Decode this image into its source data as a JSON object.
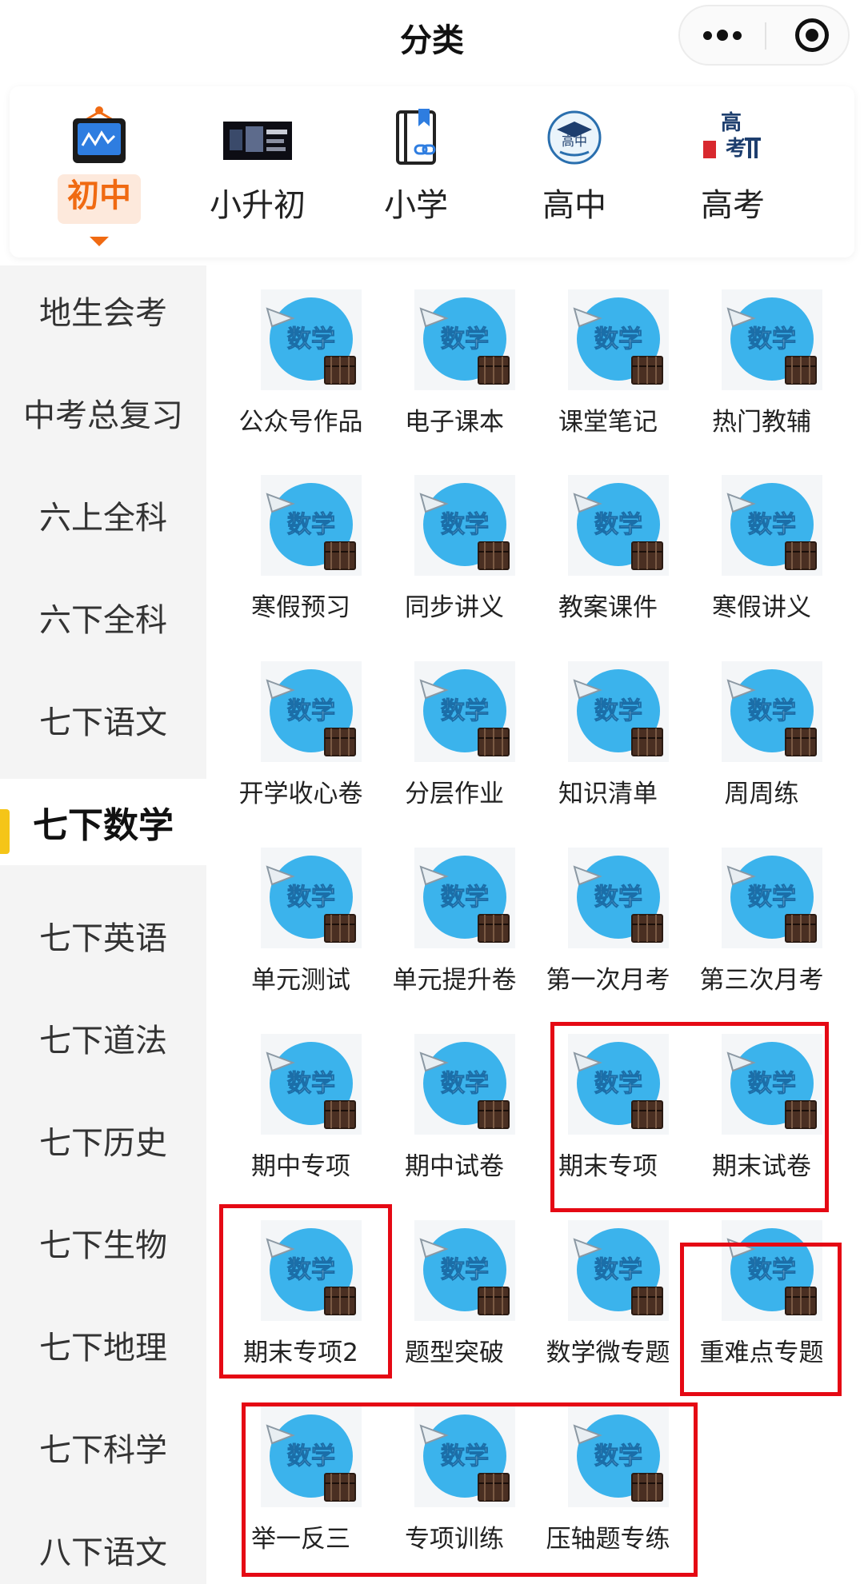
{
  "title": "分类",
  "capsule": {
    "more_icon": "more-dots-icon",
    "close_icon": "target-circle-icon"
  },
  "stages": [
    {
      "label": "初中",
      "icon": "whiteboard-icon",
      "active": true
    },
    {
      "label": "小升初",
      "icon": "banner-thumbnail-icon",
      "active": false
    },
    {
      "label": "小学",
      "icon": "book-link-icon",
      "active": false
    },
    {
      "label": "高中",
      "icon": "high-school-badge-icon",
      "active": false
    },
    {
      "label": "高考",
      "icon": "gaokao-gate-icon",
      "active": false
    }
  ],
  "sidebar": {
    "items": [
      {
        "label": "地生会考",
        "active": false
      },
      {
        "label": "中考总复习",
        "active": false
      },
      {
        "label": "六上全科",
        "active": false
      },
      {
        "label": "六下全科",
        "active": false
      },
      {
        "label": "七下语文",
        "active": false
      },
      {
        "label": "七下数学",
        "active": true
      },
      {
        "label": "七下英语",
        "active": false
      },
      {
        "label": "七下道法",
        "active": false
      },
      {
        "label": "七下历史",
        "active": false
      },
      {
        "label": "七下生物",
        "active": false
      },
      {
        "label": "七下地理",
        "active": false
      },
      {
        "label": "七下科学",
        "active": false
      },
      {
        "label": "八下语文",
        "active": false
      }
    ]
  },
  "icon_text": "数学",
  "grid": {
    "items": [
      "公众号作品",
      "电子课本",
      "课堂笔记",
      "热门教辅",
      "寒假预习",
      "同步讲义",
      "教案课件",
      "寒假讲义",
      "开学收心卷",
      "分层作业",
      "知识清单",
      "周周练",
      "单元测试",
      "单元提升卷",
      "第一次月考",
      "第三次月考",
      "期中专项",
      "期中试卷",
      "期末专项",
      "期末试卷",
      "期末专项2",
      "题型突破",
      "数学微专题",
      "重难点专题",
      "举一反三",
      "专项训练",
      "压轴题专练"
    ]
  },
  "colors": {
    "accent": "#f06a12",
    "accent_bg": "#fde9dc",
    "sidebar_marker": "#f5c518",
    "highlight": "#e50914",
    "icon_blue": "#3bb3ec"
  }
}
